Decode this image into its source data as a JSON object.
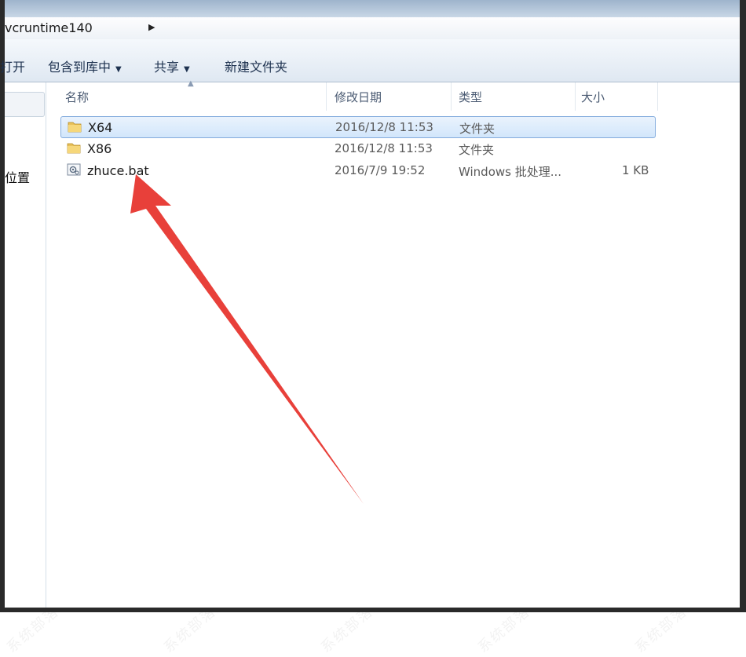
{
  "address": {
    "path_segment": "vcruntime140"
  },
  "toolbar": {
    "open": "打开",
    "include_library": "包含到库中",
    "share": "共享",
    "new_folder": "新建文件夹"
  },
  "navpane": {
    "item_partial": "位置"
  },
  "columns": {
    "name": "名称",
    "date": "修改日期",
    "type": "类型",
    "size": "大小"
  },
  "files": [
    {
      "name": "X64",
      "date": "2016/12/8 11:53",
      "type": "文件夹",
      "size": "",
      "icon": "folder-icon",
      "selected": true
    },
    {
      "name": "X86",
      "date": "2016/12/8 11:53",
      "type": "文件夹",
      "size": "",
      "icon": "folder-icon",
      "selected": false
    },
    {
      "name": "zhuce.bat",
      "date": "2016/7/9 19:52",
      "type": "Windows 批处理...",
      "size": "1 KB",
      "icon": "batch-file-icon",
      "selected": false
    }
  ],
  "annotation": {
    "color": "#e8403a"
  },
  "watermark": {
    "text": "系统部落xitongbuluo.com"
  }
}
